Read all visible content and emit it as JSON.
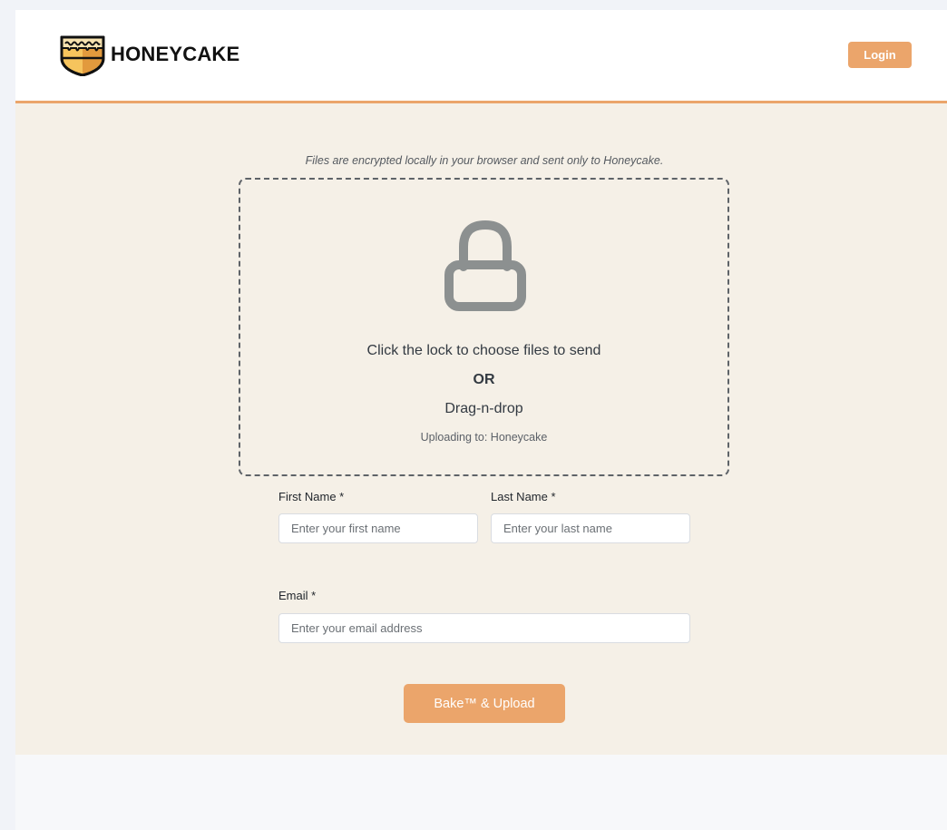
{
  "header": {
    "brand_name": "HONEYCAKE",
    "logo_icon": "honeycake-shield-logo",
    "login_label": "Login"
  },
  "upload": {
    "notice": "Files are encrypted locally in your browser and sent only to Honeycake.",
    "icon": "lock-icon",
    "instruction": "Click the lock to choose files to send",
    "or_label": "OR",
    "drag_label": "Drag-n-drop",
    "destination": "Uploading to: Honeycake"
  },
  "form": {
    "first_name": {
      "label": "First Name *",
      "placeholder": "Enter your first name",
      "value": ""
    },
    "last_name": {
      "label": "Last Name *",
      "placeholder": "Enter your last name",
      "value": ""
    },
    "email": {
      "label": "Email *",
      "placeholder": "Enter your email address",
      "value": ""
    },
    "submit_label": "Bake™ & Upload"
  },
  "colors": {
    "accent": "#eba56b",
    "page_background": "#f5f0e7",
    "lock_icon": "#8c9090"
  }
}
